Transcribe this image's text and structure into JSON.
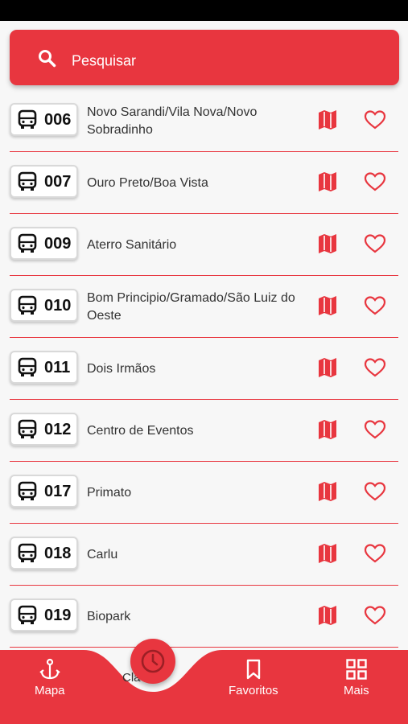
{
  "search": {
    "placeholder": "Pesquisar"
  },
  "routes": [
    {
      "number": "006",
      "name": "Novo Sarandi/Vila Nova/Novo Sobradinho"
    },
    {
      "number": "007",
      "name": "Ouro Preto/Boa Vista"
    },
    {
      "number": "009",
      "name": "Aterro Sanitário"
    },
    {
      "number": "010",
      "name": "Bom Principio/Gramado/São Luiz do Oeste"
    },
    {
      "number": "011",
      "name": "Dois Irmãos"
    },
    {
      "number": "012",
      "name": "Centro de Eventos"
    },
    {
      "number": "017",
      "name": "Primato"
    },
    {
      "number": "018",
      "name": "Carlu"
    },
    {
      "number": "019",
      "name": "Biopark"
    }
  ],
  "nav": {
    "map_label": "Mapa",
    "clock_partial_label": "Cla",
    "favorites_label": "Favoritos",
    "more_label": "Mais"
  },
  "colors": {
    "accent": "#e8363f",
    "background": "#f7f7f7"
  }
}
